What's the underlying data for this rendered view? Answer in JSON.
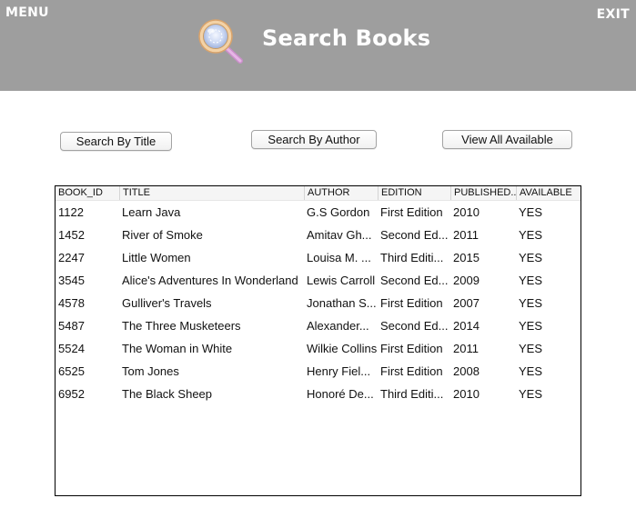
{
  "header": {
    "menu_label": "MENU",
    "exit_label": "EXIT",
    "title": "Search Books",
    "icon": "magnifier-icon",
    "background": "#9e9e9e"
  },
  "buttons": {
    "search_by_title": "Search By Title",
    "search_by_author": "Search By Author",
    "view_all_available": "View All Available"
  },
  "table": {
    "columns": [
      "BOOK_ID",
      "TITLE",
      "AUTHOR",
      "EDITION",
      "PUBLISHED...",
      "AVAILABLE"
    ],
    "rows": [
      [
        "1122",
        "Learn Java",
        "G.S Gordon",
        "First Edition",
        "2010",
        "YES"
      ],
      [
        "1452",
        "River of Smoke",
        "Amitav Gh...",
        "Second Ed...",
        "2011",
        "YES"
      ],
      [
        "2247",
        "Little Women",
        "Louisa M. ...",
        "Third Editi...",
        "2015",
        "YES"
      ],
      [
        "3545",
        "Alice's Adventures In Wonderland",
        "Lewis Carroll",
        "Second Ed...",
        "2009",
        "YES"
      ],
      [
        "4578",
        "Gulliver's Travels",
        "Jonathan S...",
        "First Edition",
        "2007",
        "YES"
      ],
      [
        "5487",
        "The Three Musketeers",
        "Alexander...",
        "Second Ed...",
        "2014",
        "YES"
      ],
      [
        "5524",
        "The Woman in White",
        "Wilkie Collins",
        "First Edition",
        "2011",
        "YES"
      ],
      [
        "6525",
        "Tom Jones",
        "Henry Fiel...",
        "First Edition",
        "2008",
        "YES"
      ],
      [
        "6952",
        "The Black Sheep",
        "Honoré De...",
        "Third Editi...",
        "2010",
        "YES"
      ]
    ]
  }
}
